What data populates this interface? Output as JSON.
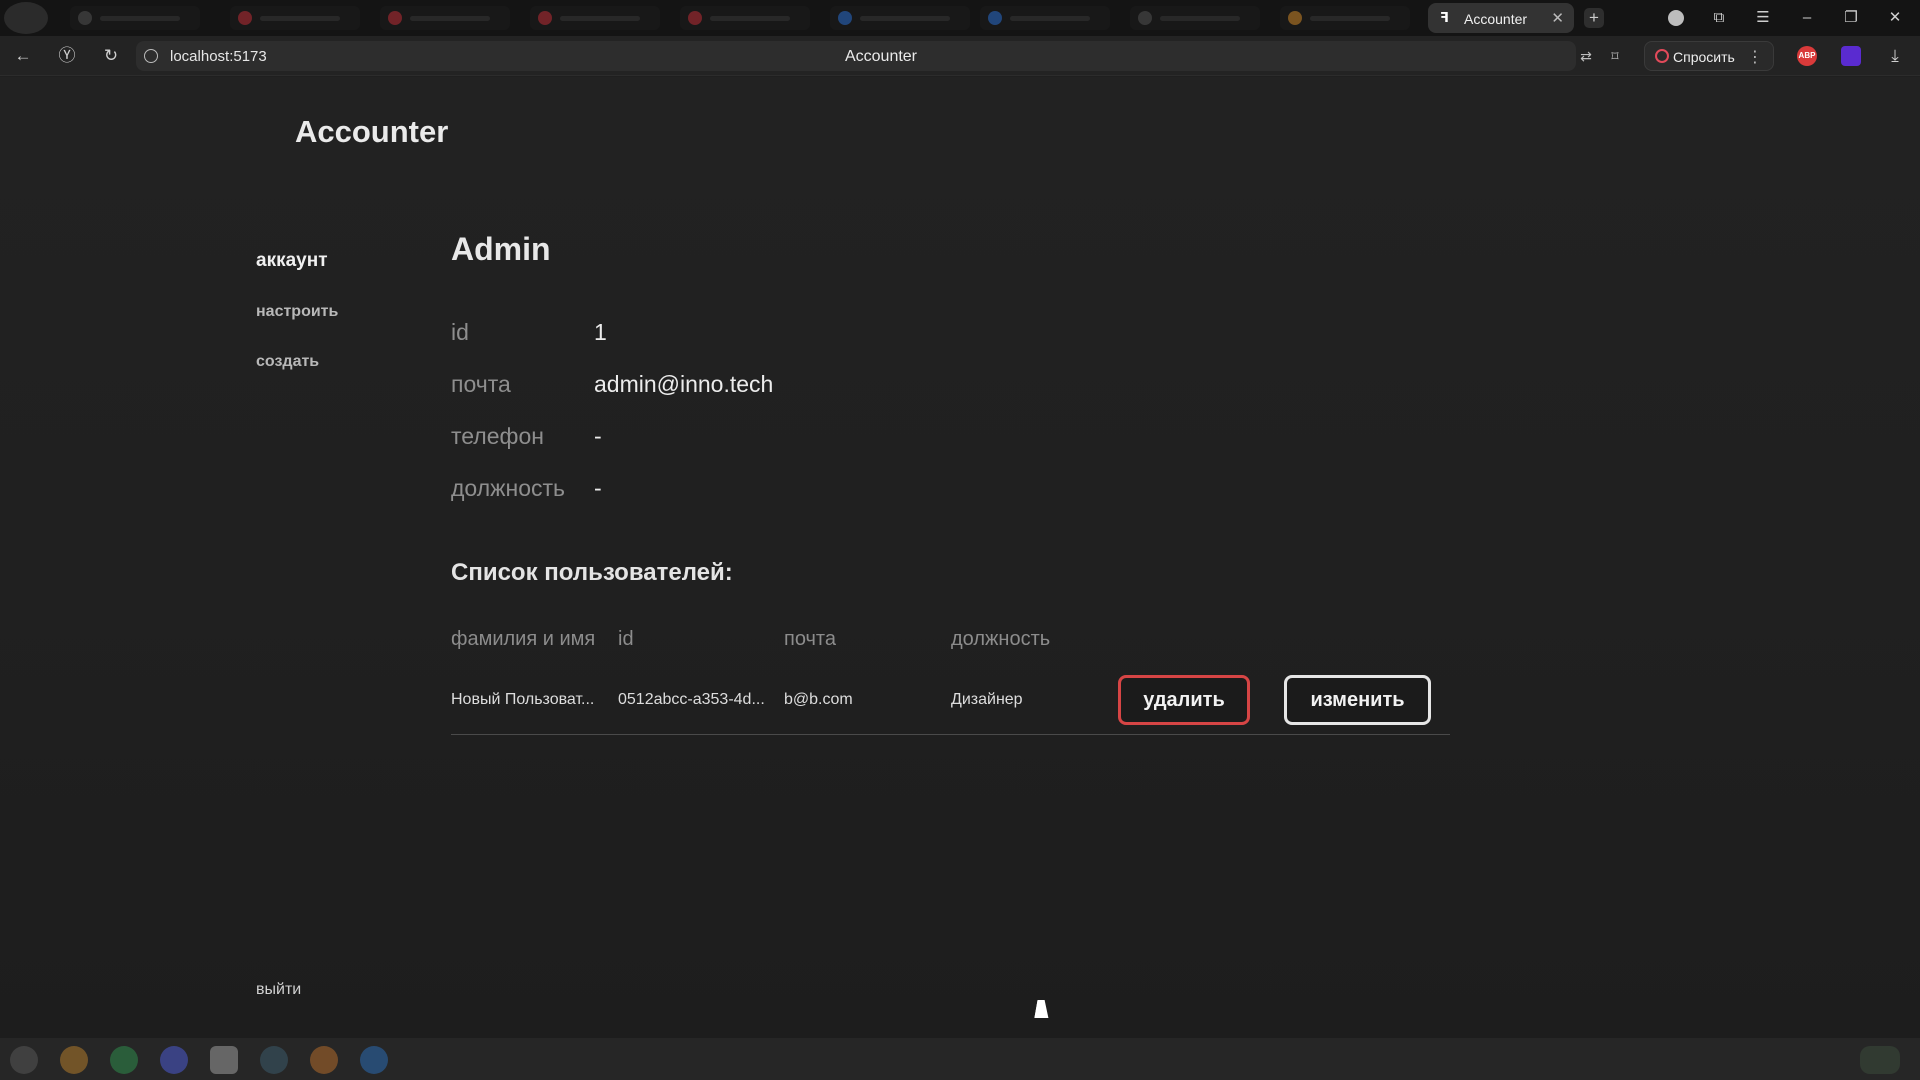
{
  "browser": {
    "tab_title": "Accounter",
    "favicon_glyph": "ꟻ",
    "close_glyph": "✕",
    "new_tab_glyph": "+",
    "url": "localhost:5173",
    "page_title": "Accounter",
    "ask_label": "Спросить",
    "ext_abp": "ABP",
    "colors": {
      "accent_red": "#e24a5a",
      "abp_red": "#d93a3a",
      "ext_purple": "#5a2bd0"
    }
  },
  "app": {
    "brand": "Accounter",
    "nav": {
      "account": "аккаунт",
      "settings": "настроить",
      "create": "создать",
      "logout": "выйти"
    },
    "profile": {
      "name": "Admin",
      "fields": [
        {
          "label": "id",
          "value": "1"
        },
        {
          "label": "почта",
          "value": "admin@inno.tech"
        },
        {
          "label": "телефон",
          "value": "-"
        },
        {
          "label": "должность",
          "value": "-"
        }
      ]
    },
    "users": {
      "title": "Список пользователей:",
      "headers": [
        "фамилия и имя",
        "id",
        "почта",
        "должность"
      ],
      "rows": [
        {
          "name": "Новый Пользоват...",
          "id": "0512abcc-a353-4d...",
          "email": "b@b.com",
          "position": "Дизайнер",
          "delete_label": "удалить",
          "edit_label": "изменить"
        }
      ]
    },
    "colors": {
      "delete_border": "#d64545",
      "edit_border": "#e6e6e6"
    }
  }
}
